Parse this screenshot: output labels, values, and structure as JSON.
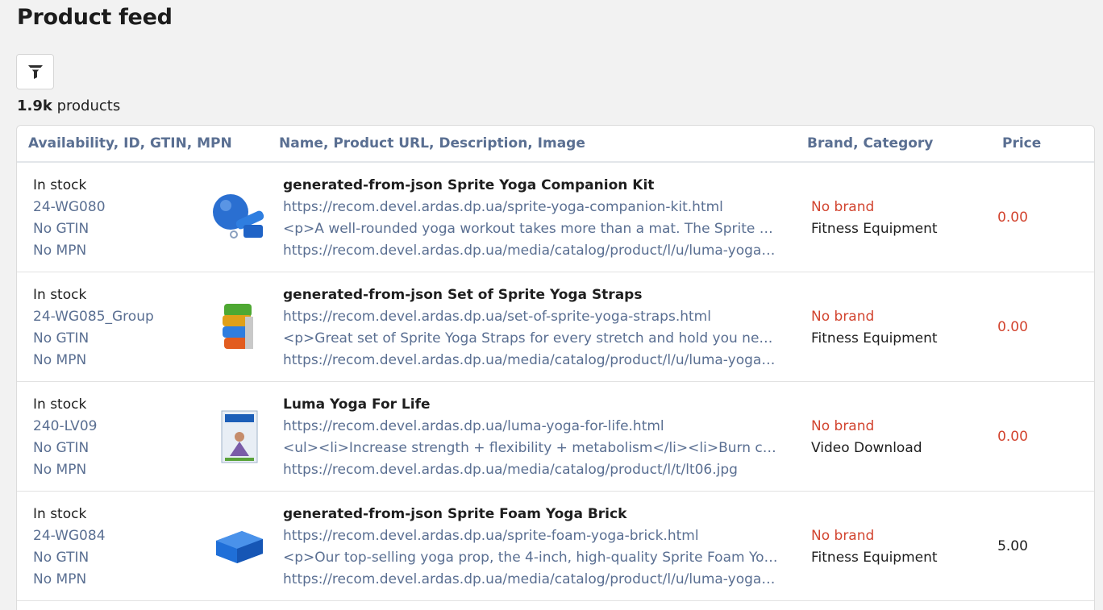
{
  "page": {
    "title": "Product feed",
    "count_value": "1.9k",
    "count_label": " products"
  },
  "icons": {
    "filter": "funnel-icon"
  },
  "columns": [
    "Availability, ID, GTIN, MPN",
    "Name, Product URL, Description, Image",
    "Brand, Category",
    "Price"
  ],
  "products": [
    {
      "availability": "In stock",
      "id": "24-WG080",
      "gtin": "No GTIN",
      "mpn": "No MPN",
      "image": "yoga-kit-thumbnail",
      "name": "generated-from-json Sprite Yoga Companion Kit",
      "url": "https://recom.devel.ardas.dp.ua/sprite-yoga-companion-kit.html",
      "description": "<p>A well-rounded yoga workout takes more than a mat. The Sprite Yoga Co...",
      "image_url": "https://recom.devel.ardas.dp.ua/media/catalog/product/l/u/luma-yoga-kit-...",
      "brand": "No brand",
      "category": "Fitness Equipment",
      "price": "0.00"
    },
    {
      "availability": "In stock",
      "id": "24-WG085_Group",
      "gtin": "No GTIN",
      "mpn": "No MPN",
      "image": "yoga-straps-thumbnail",
      "name": "generated-from-json Set of Sprite Yoga Straps",
      "url": "https://recom.devel.ardas.dp.ua/set-of-sprite-yoga-straps.html",
      "description": "<p>Great set of Sprite Yoga Straps for every stretch and hold you need. Ther...",
      "image_url": "https://recom.devel.ardas.dp.ua/media/catalog/product/l/u/luma-yoga-stra...",
      "brand": "No brand",
      "category": "Fitness Equipment",
      "price": "0.00"
    },
    {
      "availability": "In stock",
      "id": "240-LV09",
      "gtin": "No GTIN",
      "mpn": "No MPN",
      "image": "yoga-dvd-thumbnail",
      "name": "Luma Yoga For Life",
      "url": "https://recom.devel.ardas.dp.ua/luma-yoga-for-life.html",
      "description": "<ul><li>Increase strength + flexibility + metabolism</li><li>Burn calories + ...",
      "image_url": "https://recom.devel.ardas.dp.ua/media/catalog/product/l/t/lt06.jpg",
      "brand": "No brand",
      "category": "Video Download",
      "price": "0.00"
    },
    {
      "availability": "In stock",
      "id": "24-WG084",
      "gtin": "No GTIN",
      "mpn": "No MPN",
      "image": "yoga-brick-thumbnail",
      "name": "generated-from-json Sprite Foam Yoga Brick",
      "url": "https://recom.devel.ardas.dp.ua/sprite-foam-yoga-brick.html",
      "description": "<p>Our top-selling yoga prop, the 4-inch, high-quality Sprite Foam Yoga Bric...",
      "image_url": "https://recom.devel.ardas.dp.ua/media/catalog/product/l/u/luma-yoga-bric...",
      "brand": "No brand",
      "category": "Fitness Equipment",
      "price": "5.00"
    }
  ],
  "colors": {
    "accent_muted": "#5a6f92",
    "warning": "#d2442f",
    "background": "#f2f2f2"
  }
}
